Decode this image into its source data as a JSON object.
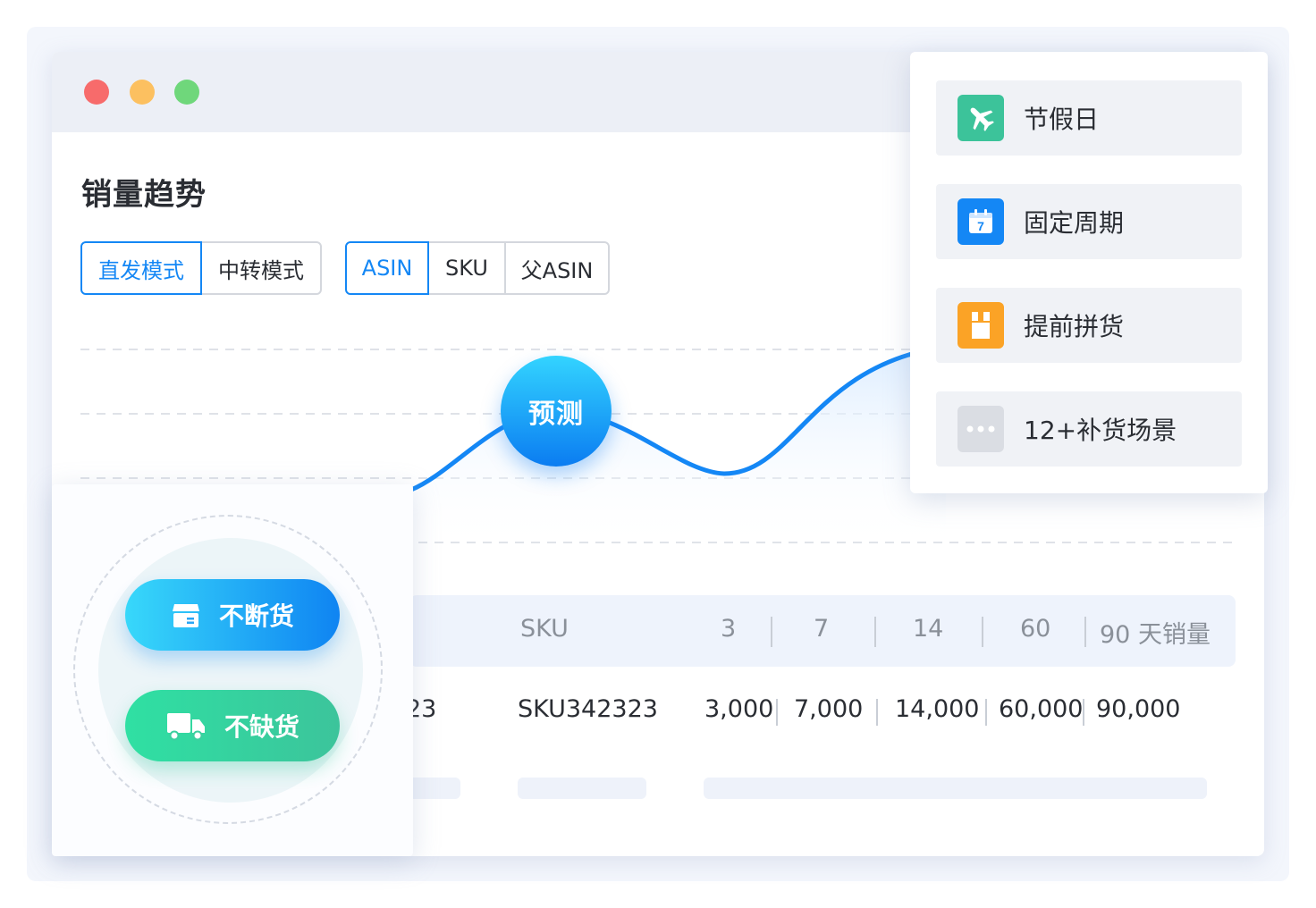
{
  "section": {
    "title": "销量趋势"
  },
  "mode_toggle": {
    "items": [
      "直发模式",
      "中转模式"
    ],
    "active": "直发模式"
  },
  "id_toggle": {
    "items": [
      "ASIN",
      "SKU",
      "父ASIN"
    ],
    "active": "ASIN"
  },
  "forecast": {
    "label": "预测"
  },
  "table": {
    "headers": {
      "sku": "SKU",
      "d3": "3",
      "d7": "7",
      "d14": "14",
      "d60": "60",
      "d90": "90 天销量"
    },
    "row": {
      "asin_tail": "23",
      "sku": "SKU342323",
      "d3": "3,000",
      "d7": "7,000",
      "d14": "14,000",
      "d60": "60,000",
      "d90": "90,000"
    }
  },
  "stock_options": {
    "no_break": "不断货",
    "no_shortage": "不缺货"
  },
  "scenarios": [
    {
      "label": "节假日",
      "icon": "airplane-icon",
      "color": "#3cc39a"
    },
    {
      "label": "固定周期",
      "icon": "calendar-icon",
      "color": "#1487f5",
      "day": "7"
    },
    {
      "label": "提前拼货",
      "icon": "package-icon",
      "color": "#fba326"
    },
    {
      "label": "12+补货场景",
      "icon": "more-icon",
      "color": "#dadde3"
    }
  ],
  "colors": {
    "accent": "#1487f5",
    "line": "#1487f5",
    "green": "#3cc39a",
    "orange": "#fba326"
  }
}
